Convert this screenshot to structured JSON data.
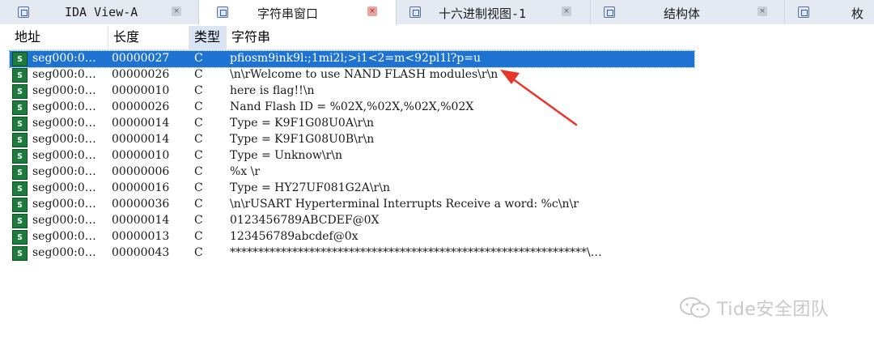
{
  "tabs": [
    {
      "label": "IDA View-A",
      "close": "×",
      "icon": "view-icon"
    },
    {
      "label": "字符串窗口",
      "close": "×",
      "icon": "strings-icon"
    },
    {
      "label": "十六进制视图-1",
      "close": "×",
      "icon": "hex-icon"
    },
    {
      "label": "结构体",
      "close": "×",
      "icon": "structs-icon"
    },
    {
      "label": "枚",
      "close": "",
      "icon": "enums-icon"
    }
  ],
  "table": {
    "columns": {
      "address": "地址",
      "length": "长度",
      "type": "类型",
      "string": "字符串"
    },
    "rows": [
      {
        "icon": "s",
        "address": "seg000:0…",
        "length": "00000027",
        "type": "C",
        "string": "pfiosm9ink9l:;1mi2l;>i1<2=m<92pl1l?p=u"
      },
      {
        "icon": "s",
        "address": "seg000:0…",
        "length": "00000026",
        "type": "C",
        "string": "\\n\\rWelcome to use NAND FLASH modules\\r\\n"
      },
      {
        "icon": "s",
        "address": "seg000:0…",
        "length": "00000010",
        "type": "C",
        "string": "here is flag!!\\n"
      },
      {
        "icon": "s",
        "address": "seg000:0…",
        "length": "00000026",
        "type": "C",
        "string": "Nand Flash ID = %02X,%02X,%02X,%02X"
      },
      {
        "icon": "s",
        "address": "seg000:0…",
        "length": "00000014",
        "type": "C",
        "string": "Type = K9F1G08U0A\\r\\n"
      },
      {
        "icon": "s",
        "address": "seg000:0…",
        "length": "00000014",
        "type": "C",
        "string": "Type = K9F1G08U0B\\r\\n"
      },
      {
        "icon": "s",
        "address": "seg000:0…",
        "length": "00000010",
        "type": "C",
        "string": "Type = Unknow\\r\\n"
      },
      {
        "icon": "s",
        "address": "seg000:0…",
        "length": "00000006",
        "type": "C",
        "string": "%x  \\r"
      },
      {
        "icon": "s",
        "address": "seg000:0…",
        "length": "00000016",
        "type": "C",
        "string": "Type = HY27UF081G2A\\r\\n"
      },
      {
        "icon": "s",
        "address": "seg000:0…",
        "length": "00000036",
        "type": "C",
        "string": "\\n\\rUSART Hyperterminal Interrupts Receive a word: %c\\n\\r"
      },
      {
        "icon": "s",
        "address": "seg000:0…",
        "length": "00000014",
        "type": "C",
        "string": "0123456789ABCDEF@0X"
      },
      {
        "icon": "s",
        "address": "seg000:0…",
        "length": "00000013",
        "type": "C",
        "string": "123456789abcdef@0x"
      },
      {
        "icon": "s",
        "address": "seg000:0…",
        "length": "00000043",
        "type": "C",
        "string": "***************************************************************\\…"
      }
    ]
  },
  "watermark": {
    "text": "Tide安全团队"
  },
  "colors": {
    "selection": "#1e73d2",
    "arrow": "#e8352a",
    "icon_green": "#1d7b3b"
  }
}
